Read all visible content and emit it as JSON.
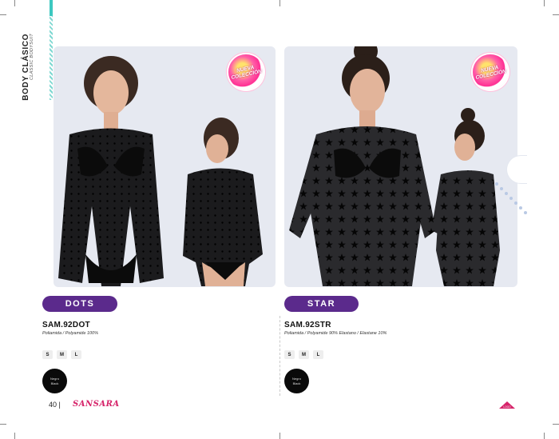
{
  "header": {
    "title": "BODY CLÁSICO",
    "subtitle": "CLASSIC BODYSUIT"
  },
  "badges": {
    "new_label": "NUEVA COLECCIÓN"
  },
  "products": [
    {
      "name": "DOTS",
      "code": "SAM.92DOT",
      "material": "Poliamida / Polyamide 100%",
      "sizes": [
        "S",
        "M",
        "L"
      ],
      "color": {
        "es": "Negro",
        "en": "Black",
        "hex": "#0a0a0a"
      }
    },
    {
      "name": "STAR",
      "code": "SAM.92STR",
      "material": "Poliamida / Polyamide 90% Elastano / Elastane 10%",
      "sizes": [
        "S",
        "M",
        "L"
      ],
      "color": {
        "es": "Negro",
        "en": "Black",
        "hex": "#0a0a0a"
      }
    }
  ],
  "footer": {
    "page": "40 |",
    "brand": "SANSARA",
    "brand_color": "#d6246a",
    "logo_label": "LOGO"
  },
  "colors": {
    "accent_purple": "#5b2a8c",
    "accent_teal": "#3cc8c0",
    "photo_bg": "#e6e9f1"
  }
}
